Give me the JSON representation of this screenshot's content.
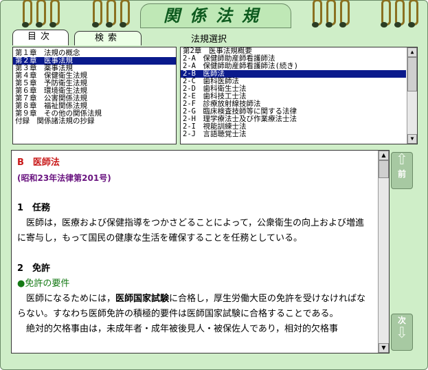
{
  "app": {
    "title": "関係法規"
  },
  "tabs": [
    {
      "label": "目次"
    },
    {
      "label": "検索"
    }
  ],
  "law_select_label": "法規選択",
  "toc": [
    "第１章　法規の概念",
    "第２章　医事法規",
    "第３章　薬事法規",
    "第４章　保健衛生法規",
    "第５章　予防衛生法規",
    "第６章　環境衛生法規",
    "第７章　公害関係法規",
    "第８章　福祉関係法規",
    "第９章　その他の関係法規",
    "付録　関係諸法規の抄録"
  ],
  "toc_selected_index": 1,
  "laws": [
    "第2章　医事法規概要",
    "2-A　保健師助産師看護師法",
    "2-A　保健師助産師看護師法(続き)",
    "2-B　医師法",
    "2-C　歯科医師法",
    "2-D　歯科衛生士法",
    "2-E　歯科技工士法",
    "2-F　診療放射線技師法",
    "2-G　臨床検査技師等に関する法律",
    "2-H　理学療法士及び作業療法士法",
    "2-I　視能訓練士法",
    "2-J　言語聴覚士法"
  ],
  "laws_selected_index": 3,
  "content": {
    "title": "B　医師法",
    "subtitle": "(昭和23年法律第201号)",
    "s1_heading": "1　任務",
    "s1_body": "　医師は，医療および保健指導をつかさどることによって，公衆衛生の向上および増進に寄与し，もって国民の健康な生活を確保することを任務としている。",
    "s2_heading": "2　免許",
    "s2_sub": "●免許の要件",
    "s2_body_pre": "　医師になるためには，",
    "s2_body_bold": "医師国家試験",
    "s2_body_post": "に合格し，厚生労働大臣の免許を受けなければならない。すなわち医師免許の積極的要件は医師国家試験に合格することである。",
    "s2_body2": "　絶対的欠格事由は，未成年者・成年被後見人・被保佐人であり，相対的欠格事"
  },
  "nav": {
    "prev_label": "前",
    "next_label": "次"
  },
  "colors": {
    "background": "#cfeec8",
    "selection": "#0a1a8c",
    "title": "#c81818",
    "subtitle": "#6a1580",
    "sub_heading": "#157a15"
  }
}
